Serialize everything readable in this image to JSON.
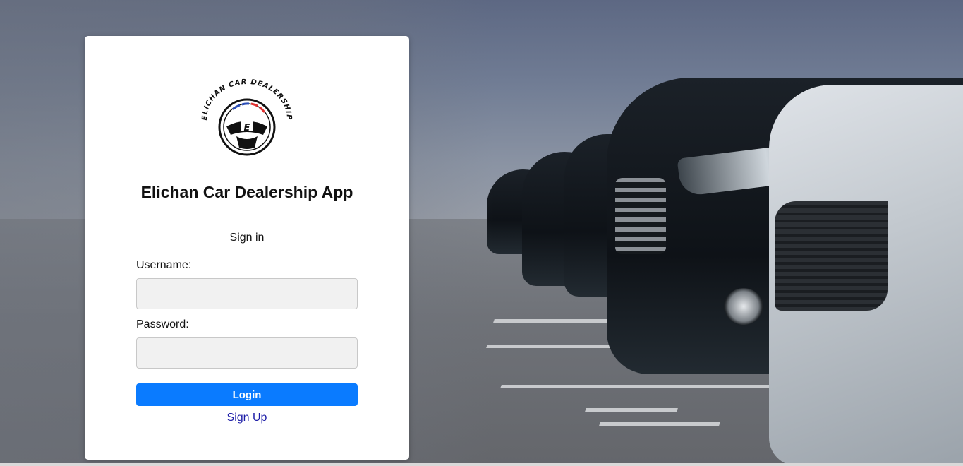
{
  "logo": {
    "text": "ELICHAN CAR DEALERSHIP",
    "letter": "E"
  },
  "app": {
    "title": "Elichan Car Dealership App"
  },
  "form": {
    "heading": "Sign in",
    "username_label": "Username:",
    "username_value": "",
    "password_label": "Password:",
    "password_value": "",
    "login_label": "Login",
    "signup_label": "Sign Up"
  },
  "colors": {
    "primary": "#0a7bff",
    "link": "#1a1aa6",
    "card": "#ffffff"
  },
  "background": {
    "image": "parked-cars-photo"
  }
}
